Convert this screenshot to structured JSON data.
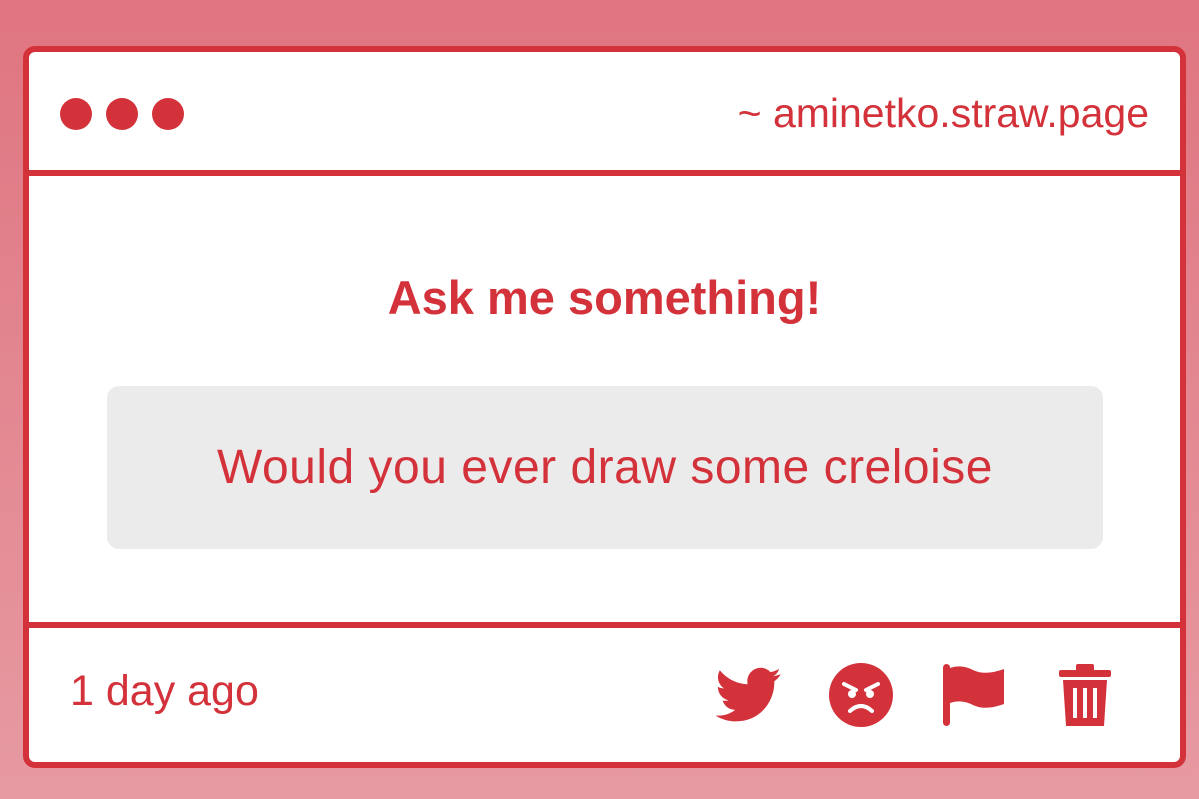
{
  "window": {
    "url": "~ aminetko.straw.page",
    "traffic_lights": [
      "dot",
      "dot",
      "dot"
    ]
  },
  "main": {
    "heading": "Ask me something!",
    "question": "Would you ever draw some creloise"
  },
  "footer": {
    "timestamp": "1 day ago",
    "actions": [
      {
        "icon": "twitter-icon"
      },
      {
        "icon": "angry-face-icon"
      },
      {
        "icon": "flag-icon"
      },
      {
        "icon": "trash-icon"
      }
    ]
  },
  "colors": {
    "accent": "#d3323a",
    "background_top": "#df7580",
    "background_bottom": "#e79aa2",
    "question_box": "#ecebec",
    "window": "#ffffff"
  }
}
